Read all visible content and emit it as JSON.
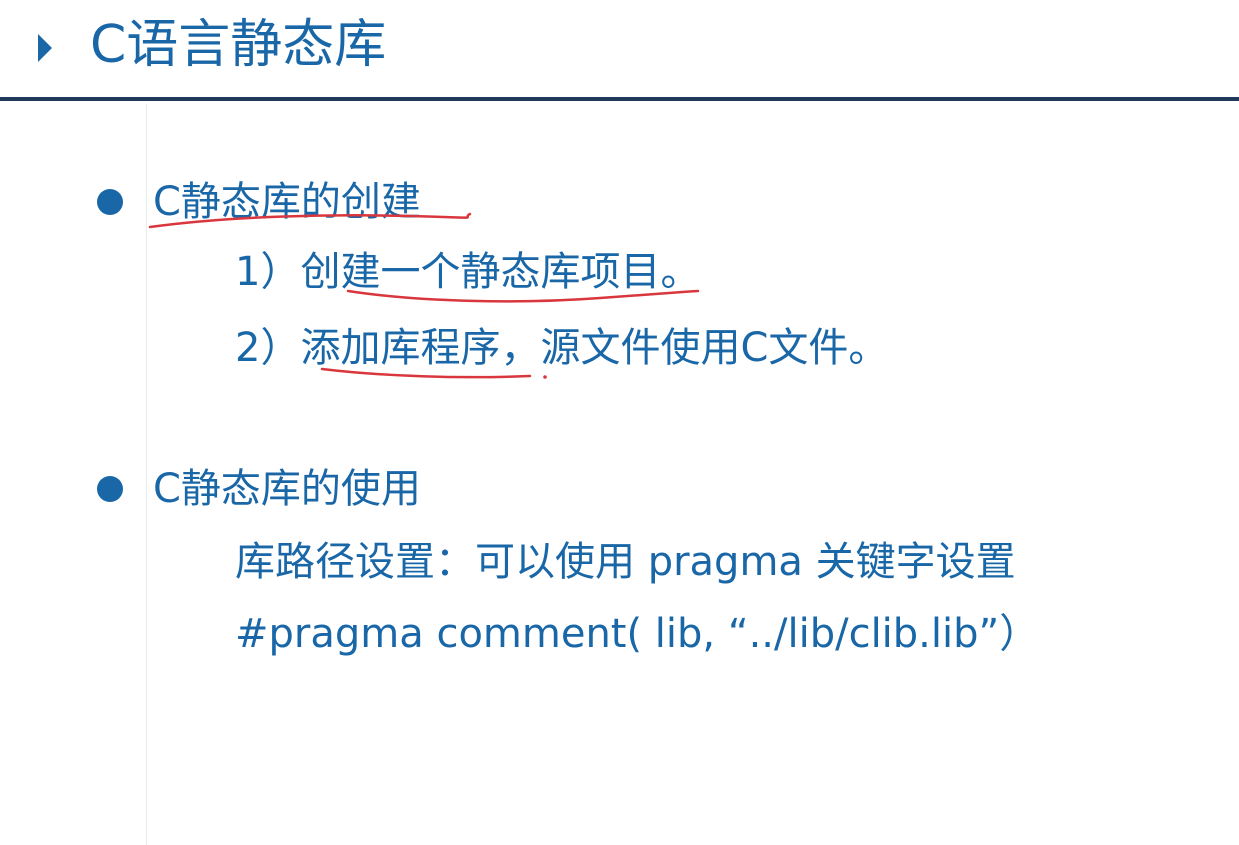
{
  "title": "C语言静态库",
  "sections": [
    {
      "heading": "C静态库的创建",
      "lines": [
        "1）创建一个静态库项目。",
        "2）添加库程序，源文件使用C文件。"
      ]
    },
    {
      "heading": "C静态库的使用",
      "lines": [
        "库路径设置：可以使用 pragma 关键字设置",
        "#pragma comment( lib, “../lib/clib.lib”）"
      ]
    }
  ],
  "colors": {
    "accent": "#1a67a8",
    "rule": "#1f3a5a",
    "annotation": "#d9363e"
  }
}
